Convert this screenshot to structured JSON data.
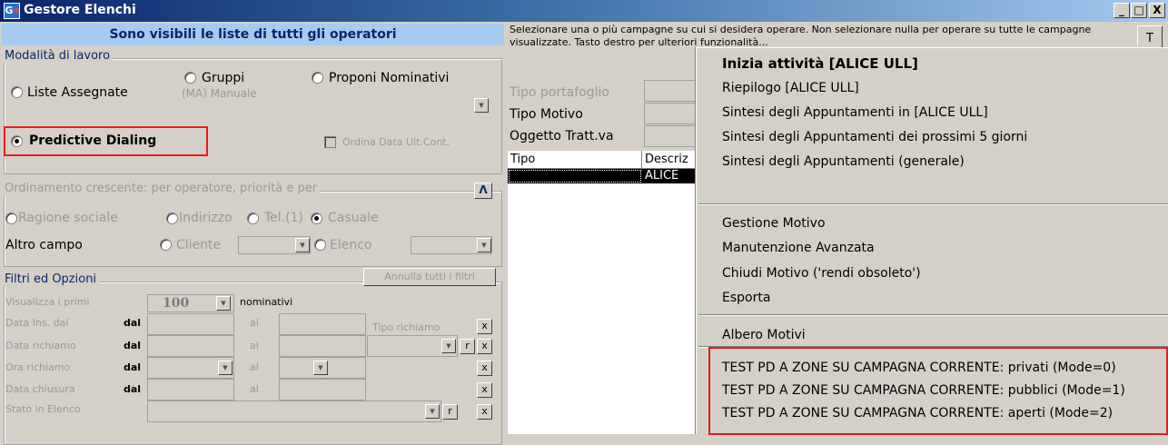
{
  "window": {
    "title": "Gestore Elenchi",
    "icon_letter": "G",
    "icon_sub": "4",
    "minimize": "_",
    "maximize": "□",
    "close": "X"
  },
  "left": {
    "banner": "Sono visibili le liste di tutti gli operatori",
    "mode": {
      "legend": "Modalità di lavoro",
      "liste_assegnate": "Liste Assegnate",
      "gruppi": "Gruppi",
      "gruppi_sub": "(MA) Manuale",
      "proponi": "Proponi Nominativi",
      "predictive": "Predictive Dialing",
      "ordina": "Ordina Data Ult.Cont.",
      "selected": "Predictive Dialing"
    },
    "order": {
      "legend": "Ordinamento crescente: per operatore, priorità e per",
      "sort_btn": "Λ",
      "ragione": "Ragione sociale",
      "indirizzo": "Indirizzo",
      "tel": "Tel.(1)",
      "casuale": "Casuale",
      "altro_campo": "Altro campo",
      "cliente": "Cliente",
      "elenco": "Elenco",
      "selected": "Casuale"
    },
    "filters": {
      "legend": "Filtri ed Opzioni",
      "annulla": "Annulla tutti i filtri",
      "visualizza": "Visualizza i primi",
      "count": "100",
      "nominativi": "nominativi",
      "data_ins": "Data Ins. dal",
      "data_richiamo": "Data richiamo",
      "ora_richiamo": "Ora richiamo",
      "data_chiusura": "Data chiusura",
      "stato": "Stato in Elenco",
      "dal": "dal",
      "al": "al",
      "tipo_richiamo": "Tipo richiamo",
      "x": "x",
      "r": "r"
    }
  },
  "right": {
    "instructions": "Selezionare una o più campagne su cui si desidera operare. Non selezionare nulla per operare su tutte le campagne visualizzate. Tasto destro per ulteriori funzionalità...",
    "t_button": "T",
    "labels": [
      "Tipo portafoglio",
      "Tipo Motivo",
      "Oggetto Tratt.va"
    ],
    "grid": {
      "columns": [
        "Tipo",
        "Descriz"
      ],
      "selected_row": [
        "",
        "ALICE"
      ]
    }
  },
  "context_menu": {
    "group1": [
      "Inizia attività [ALICE ULL]",
      "Riepilogo [ALICE ULL]",
      "Sintesi degli Appuntamenti in [ALICE ULL]",
      "Sintesi degli Appuntamenti dei prossimi 5 giorni",
      "Sintesi degli Appuntamenti (generale)"
    ],
    "group2": [
      "Gestione Motivo",
      "Manutenzione Avanzata",
      "Chiudi Motivo ('rendi obsoleto')",
      "Esporta"
    ],
    "group3": [
      "Albero Motivi"
    ],
    "group4": [
      "TEST PD A ZONE SU CAMPAGNA CORRENTE: privati (Mode=0)",
      "TEST PD A ZONE SU CAMPAGNA CORRENTE: pubblici (Mode=1)",
      "TEST PD A ZONE SU CAMPAGNA CORRENTE: aperti (Mode=2)"
    ]
  }
}
